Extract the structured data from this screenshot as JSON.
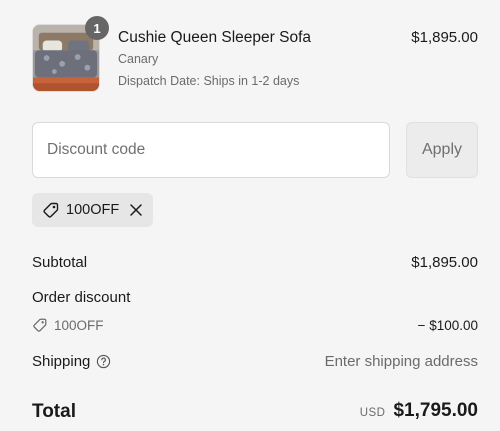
{
  "line_item": {
    "quantity": "1",
    "name": "Cushie Queen Sleeper Sofa",
    "variant": "Canary",
    "dispatch": "Dispatch Date: Ships in 1-2 days",
    "price": "$1,895.00",
    "image_icon": "product-photo-bed"
  },
  "discount": {
    "placeholder": "Discount code",
    "value": "",
    "apply_label": "Apply",
    "applied_code": "100OFF"
  },
  "summary": {
    "subtotal_label": "Subtotal",
    "subtotal_value": "$1,895.00",
    "order_discount_label": "Order discount",
    "order_discount_code": "100OFF",
    "order_discount_value": "− $100.00",
    "shipping_label": "Shipping",
    "shipping_value": "Enter shipping address",
    "total_label": "Total",
    "currency": "USD",
    "total_value": "$1,795.00"
  },
  "colors": {
    "background": "#f5f5f5",
    "text": "#1a1a1a",
    "muted": "#6b6b6b",
    "badge": "#666666"
  }
}
